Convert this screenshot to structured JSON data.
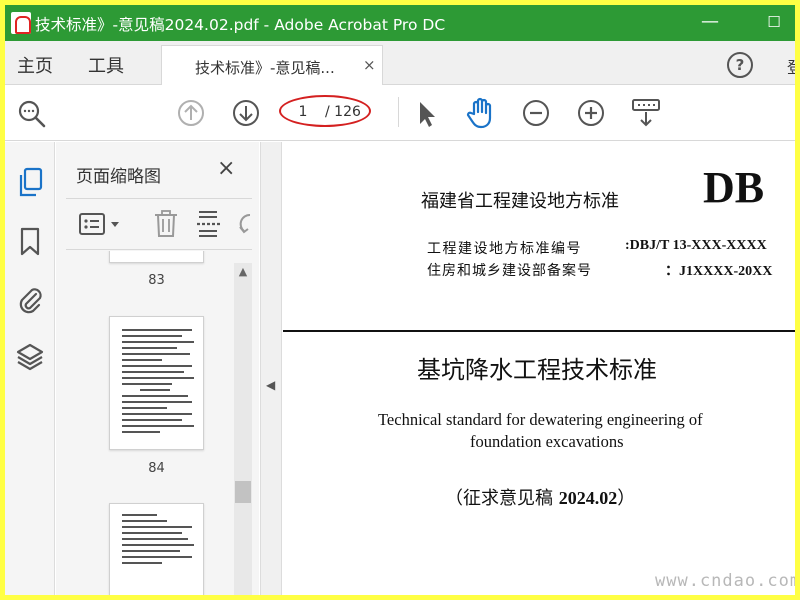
{
  "window": {
    "title": "技术标准》-意见稿2024.02.pdf - Adobe Acrobat Pro DC",
    "minimize_glyph": "—",
    "maximize_glyph": "☐"
  },
  "tabs": {
    "home_label": "主页",
    "tools_label": "工具",
    "doc_tab_label": "技术标准》-意见稿...",
    "doc_tab_close": "×",
    "help_glyph": "?",
    "signin_partial": "登"
  },
  "toolbar": {
    "current_page": "1",
    "page_total": "/ 126"
  },
  "thumbnails": {
    "panel_title": "页面缩略图",
    "close_glyph": "×",
    "pages": [
      {
        "label": "83"
      },
      {
        "label": "84"
      },
      {
        "label": ""
      }
    ]
  },
  "document": {
    "province_standard": "福建省工程建设地方标准",
    "db_mark": "DB",
    "code_label": "工程建设地方标准编号",
    "code_value": ":DBJ/T 13-XXX-XXXX",
    "record_label": "住房和城乡建设部备案号",
    "record_value": "：J1XXXX-20XX",
    "title_cn": "基坑降水工程技术标准",
    "title_en_line1": "Technical standard for dewatering engineering of",
    "title_en_line2": "foundation excavations",
    "draft_prefix": "（征求意见稿 ",
    "draft_version": "2024.02",
    "draft_suffix": "）"
  },
  "watermark": "www.cndao.com",
  "colors": {
    "titlebar": "#2d9a35",
    "accent_blue": "#1a73c8",
    "annotation_red": "#d42020",
    "outer_border": "#ffff44"
  },
  "icons": {
    "left_rail": [
      "page-thumbnails-icon",
      "bookmark-icon",
      "attachment-icon",
      "layers-icon"
    ],
    "toolbar": [
      "zoom-search-icon",
      "previous-page-icon",
      "next-page-icon",
      "select-cursor-icon",
      "hand-tool-icon",
      "zoom-out-icon",
      "zoom-in-icon",
      "keyboard-scroll-icon"
    ]
  }
}
